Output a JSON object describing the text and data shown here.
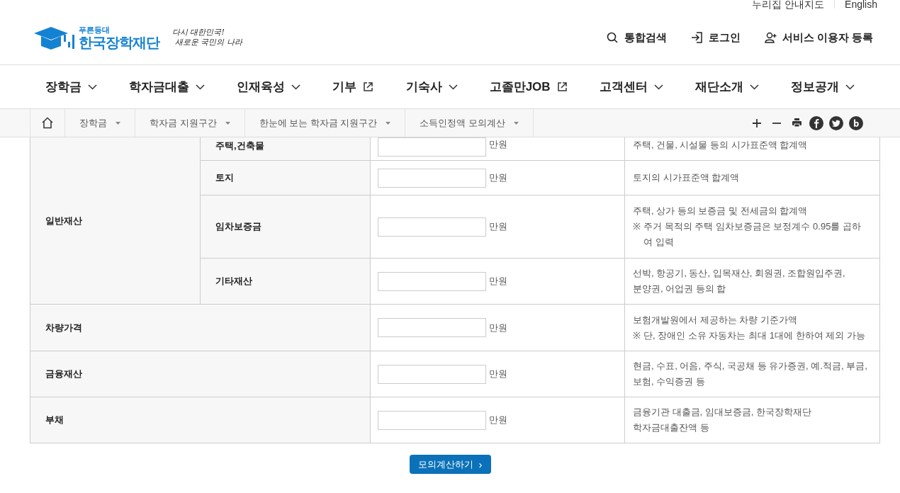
{
  "utility_links": [
    "누리집 안내지도",
    "English"
  ],
  "logo": {
    "tagline": "푸른등대",
    "name": "한국장학재단"
  },
  "slogan": [
    "다시 대한민국!",
    "새로운 국민의 나라"
  ],
  "header_links": [
    {
      "kind": "search",
      "label": "통합검색"
    },
    {
      "kind": "login",
      "label": "로그인"
    },
    {
      "kind": "register",
      "label": "서비스 이용자 등록"
    }
  ],
  "nav": [
    {
      "label": "장학금",
      "kind": "dropdown"
    },
    {
      "label": "학자금대출",
      "kind": "dropdown"
    },
    {
      "label": "인재육성",
      "kind": "dropdown"
    },
    {
      "label": "기부",
      "kind": "external"
    },
    {
      "label": "기숙사",
      "kind": "dropdown"
    },
    {
      "label": "고졸만JOB",
      "kind": "external"
    },
    {
      "label": "고객센터",
      "kind": "dropdown"
    },
    {
      "label": "재단소개",
      "kind": "dropdown"
    },
    {
      "label": "정보공개",
      "kind": "dropdown"
    }
  ],
  "breadcrumb": [
    "장학금",
    "학자금 지원구간",
    "한눈에 보는 학자금 지원구간",
    "소득인정액 모의계산"
  ],
  "toolbar": [
    {
      "kind": "zoom-in"
    },
    {
      "kind": "zoom-out"
    },
    {
      "kind": "print"
    },
    {
      "kind": "facebook"
    },
    {
      "kind": "twitter"
    },
    {
      "kind": "blog"
    }
  ],
  "table": {
    "rows": [
      {
        "label": "일반재산",
        "children": [
          {
            "label": "주택,건축물",
            "unit": "만원",
            "description": "주택, 건물, 시설물 등의 시가표준액 합계액"
          },
          {
            "label": "토지",
            "unit": "만원",
            "description": "토지의 시가표준액 합계액"
          },
          {
            "label": "임차보증금",
            "unit": "만원",
            "description": "주택, 상가 등의 보증금 및 전세금의 합계액",
            "note": {
              "mark": "※",
              "text": "주거 목적의 주택 임차보증금은 보정계수 0.95를 곱하여 입력"
            }
          },
          {
            "label": "기타재산",
            "unit": "만원",
            "description": [
              "선박, 항공기, 동산, 입목재산, 회원권, 조합원입주권,",
              "분양권, 어업권 등의 합"
            ]
          }
        ]
      },
      {
        "label": "차량가격",
        "unit": "만원",
        "description": "보험개발원에서 제공하는 차량 기준가액",
        "note": {
          "mark": "※",
          "text": "단, 장애인 소유 자동차는 최대 1대에 한하여 제외 가능"
        }
      },
      {
        "label": "금융재산",
        "unit": "만원",
        "description": [
          "현금, 수표, 어음, 주식, 국공채 등 유가증권, 예.적금, 부금,",
          "보험, 수익증권 등"
        ]
      },
      {
        "label": "부채",
        "unit": "만원",
        "description": [
          "금융기관 대출금, 임대보증금, 한국장학재단",
          "학자금대출잔액 등"
        ]
      }
    ]
  },
  "submit": {
    "label": "모의계산하기",
    "icon": "›"
  }
}
